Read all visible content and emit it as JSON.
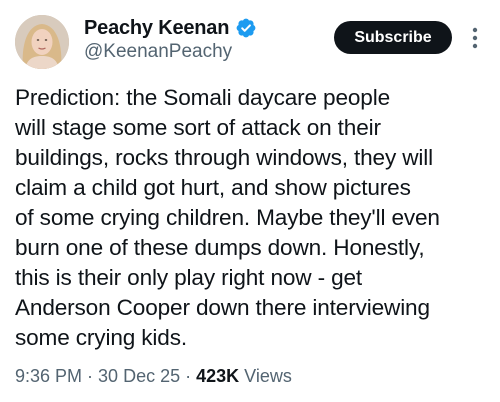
{
  "author": {
    "display_name": "Peachy Keenan",
    "handle": "@KeenanPeachy",
    "verified": true
  },
  "actions": {
    "subscribe_label": "Subscribe"
  },
  "tweet": {
    "text": "Prediction: the Somali daycare people\nwill stage some sort of attack on their\nbuildings, rocks through windows, they will\nclaim a child got hurt, and show pictures\nof some crying children. Maybe they'll even\nburn one of these dumps down. Honestly,\nthis is their only play right now - get\nAnderson Cooper down there interviewing\nsome crying kids."
  },
  "meta": {
    "time": "9:36 PM",
    "date": "30 Dec 25",
    "views_count": "423K",
    "views_label": "Views",
    "separator": "·"
  },
  "colors": {
    "text_primary": "#0f1419",
    "text_secondary": "#536471",
    "verified_blue": "#1d9bf0",
    "button_bg": "#0f1419",
    "button_text": "#ffffff"
  },
  "icons": {
    "verified": "verified-badge-icon",
    "more": "more-vertical-icon"
  }
}
